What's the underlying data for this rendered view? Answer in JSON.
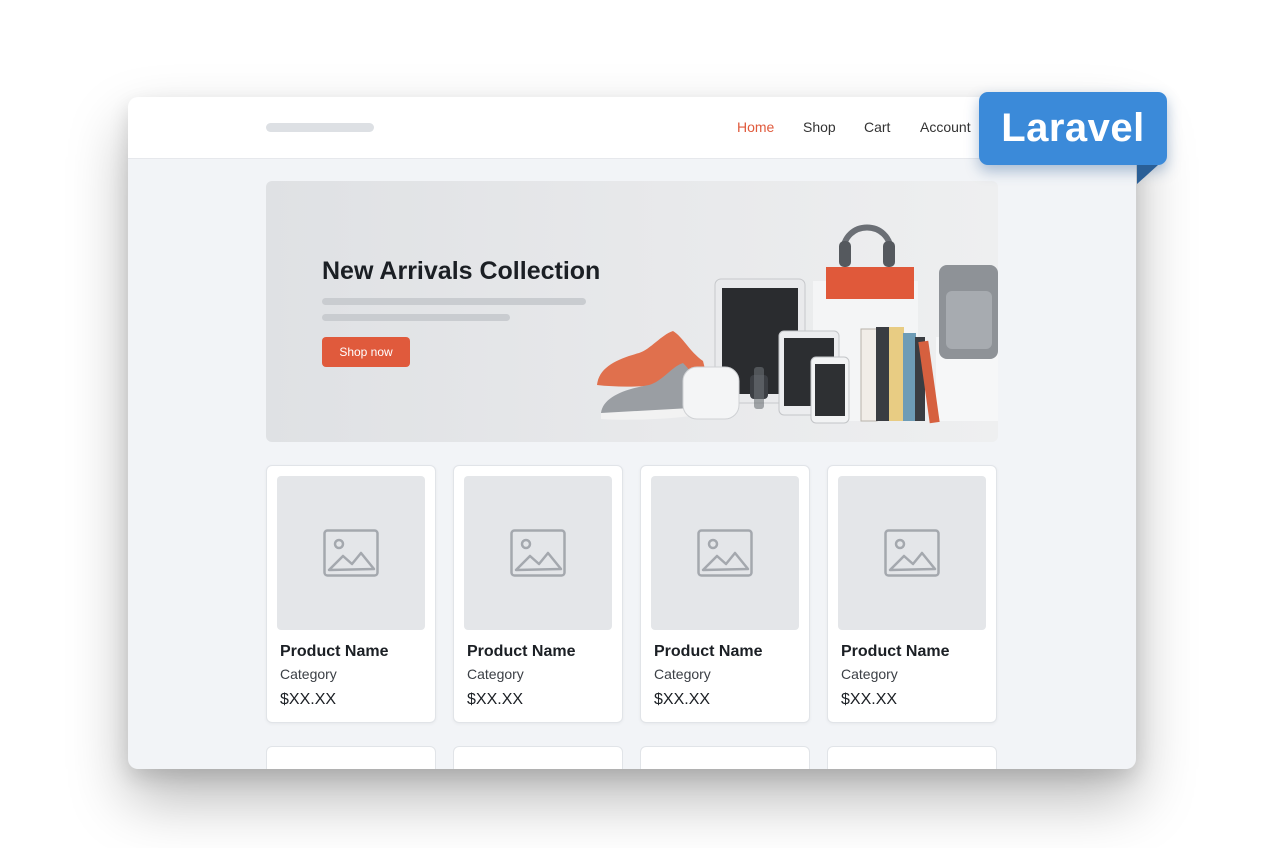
{
  "nav": {
    "links": [
      "Home",
      "Shop",
      "Cart",
      "Account"
    ],
    "active": "Home"
  },
  "hero": {
    "title": "New Arrivals Collection",
    "button_label": "Shop now"
  },
  "products": [
    {
      "name": "Product Name",
      "category": "Category",
      "price": "$XX.XX"
    },
    {
      "name": "Product Name",
      "category": "Category",
      "price": "$XX.XX"
    },
    {
      "name": "Product Name",
      "category": "Category",
      "price": "$XX.XX"
    },
    {
      "name": "Product Name",
      "category": "Category",
      "price": "$XX.XX"
    }
  ],
  "badge": {
    "label": "Laravel"
  },
  "colors": {
    "accent": "#e05a3c",
    "badge": "#3b8ad9",
    "page_bg": "#f2f4f7"
  },
  "icons": {
    "product_image": "image-placeholder-icon"
  }
}
